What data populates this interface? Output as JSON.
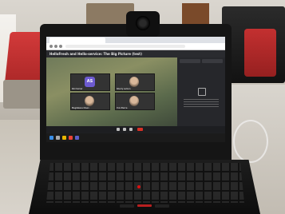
{
  "meeting": {
    "title": "HelloFresh and Hello-service: The Big Picture (test)"
  },
  "participants": [
    {
      "name": "Kiki Somer",
      "initials": "AS",
      "kind": "avatar"
    },
    {
      "name": "Sherry Lemon",
      "initials": "",
      "kind": "photo"
    },
    {
      "name": "Magdalene Olsen",
      "initials": "",
      "kind": "photo"
    },
    {
      "name": "Yoni Pierce",
      "initials": "",
      "kind": "photo"
    }
  ],
  "side_panel": {
    "tabs": [
      "",
      ""
    ]
  },
  "colors": {
    "avatar": "#6d5bd0",
    "leave": "#d93025",
    "trackpoint": "#dd1111"
  },
  "icons": [
    "webcam-icon",
    "camera-icon",
    "microphone-icon",
    "leave-call-icon",
    "windows-start-icon"
  ]
}
